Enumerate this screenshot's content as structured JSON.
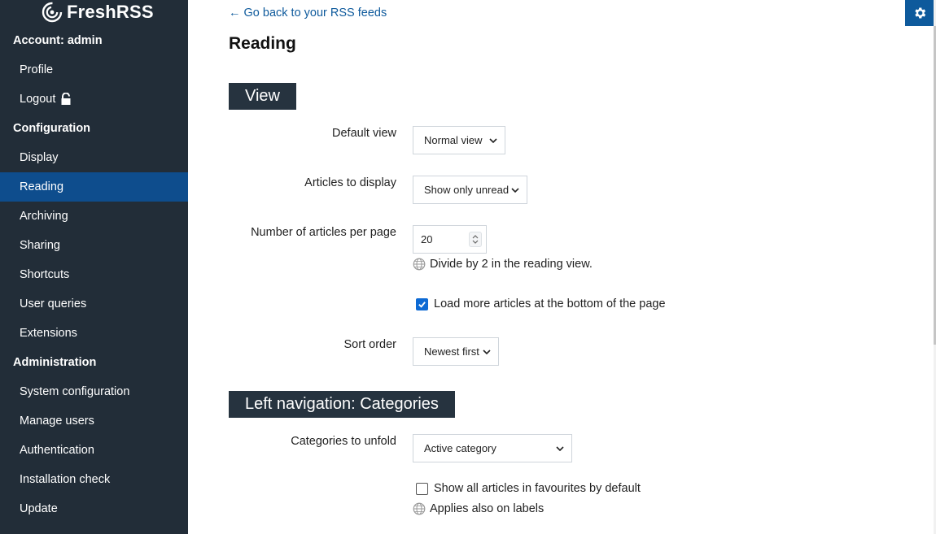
{
  "app": {
    "name": "FreshRSS"
  },
  "sidebar": {
    "account_heading": "Account: admin",
    "account_items": [
      {
        "label": "Profile"
      },
      {
        "label": "Logout"
      }
    ],
    "config_heading": "Configuration",
    "config_items": [
      {
        "label": "Display"
      },
      {
        "label": "Reading",
        "active": true
      },
      {
        "label": "Archiving"
      },
      {
        "label": "Sharing"
      },
      {
        "label": "Shortcuts"
      },
      {
        "label": "User queries"
      },
      {
        "label": "Extensions"
      }
    ],
    "admin_heading": "Administration",
    "admin_items": [
      {
        "label": "System configuration"
      },
      {
        "label": "Manage users"
      },
      {
        "label": "Authentication"
      },
      {
        "label": "Installation check"
      },
      {
        "label": "Update"
      }
    ]
  },
  "main": {
    "back_link": "← Go back to your RSS feeds",
    "title": "Reading",
    "sections": {
      "view": {
        "heading": "View",
        "default_view": {
          "label": "Default view",
          "value": "Normal view"
        },
        "articles_to_display": {
          "label": "Articles to display",
          "value": "Show only unread"
        },
        "articles_per_page": {
          "label": "Number of articles per page",
          "value": "20",
          "help": "Divide by 2 in the reading view."
        },
        "load_more": {
          "label": "Load more articles at the bottom of the page",
          "checked": true
        },
        "sort_order": {
          "label": "Sort order",
          "value": "Newest first"
        }
      },
      "left_nav": {
        "heading": "Left navigation: Categories",
        "categories_to_unfold": {
          "label": "Categories to unfold",
          "value": "Active category"
        },
        "show_all_favourites": {
          "label": "Show all articles in favourites by default",
          "checked": false
        },
        "labels_help": "Applies also on labels"
      }
    }
  },
  "colors": {
    "sidebar_bg": "#222d38",
    "active_item": "#0e4d8d",
    "section_head": "#26333f",
    "accent": "#0e5a9c"
  },
  "icons": [
    "freshrss-logo-icon",
    "lock-icon",
    "gear-icon",
    "globe-icon",
    "chevron-down-icon",
    "checkbox-icon"
  ]
}
